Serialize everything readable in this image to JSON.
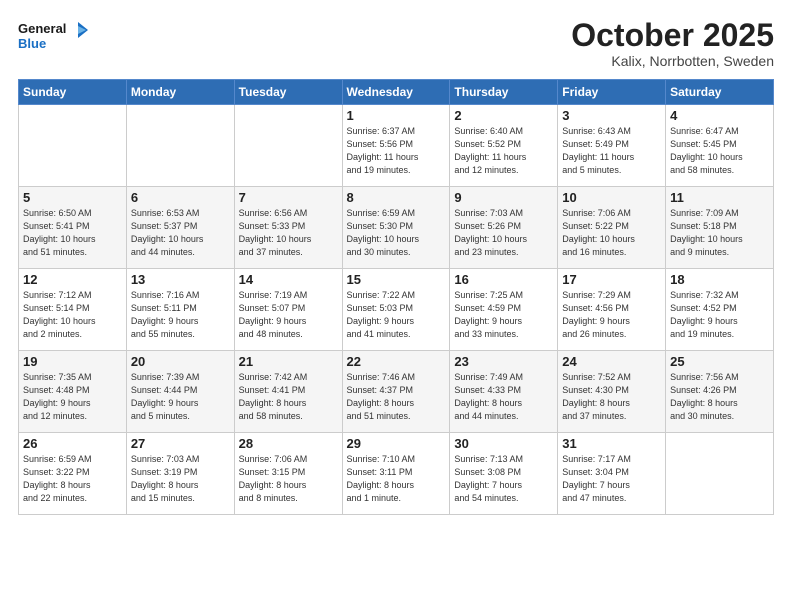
{
  "header": {
    "logo_line1": "General",
    "logo_line2": "Blue",
    "month": "October 2025",
    "location": "Kalix, Norrbotten, Sweden"
  },
  "weekdays": [
    "Sunday",
    "Monday",
    "Tuesday",
    "Wednesday",
    "Thursday",
    "Friday",
    "Saturday"
  ],
  "weeks": [
    [
      {
        "day": "",
        "info": ""
      },
      {
        "day": "",
        "info": ""
      },
      {
        "day": "",
        "info": ""
      },
      {
        "day": "1",
        "info": "Sunrise: 6:37 AM\nSunset: 5:56 PM\nDaylight: 11 hours\nand 19 minutes."
      },
      {
        "day": "2",
        "info": "Sunrise: 6:40 AM\nSunset: 5:52 PM\nDaylight: 11 hours\nand 12 minutes."
      },
      {
        "day": "3",
        "info": "Sunrise: 6:43 AM\nSunset: 5:49 PM\nDaylight: 11 hours\nand 5 minutes."
      },
      {
        "day": "4",
        "info": "Sunrise: 6:47 AM\nSunset: 5:45 PM\nDaylight: 10 hours\nand 58 minutes."
      }
    ],
    [
      {
        "day": "5",
        "info": "Sunrise: 6:50 AM\nSunset: 5:41 PM\nDaylight: 10 hours\nand 51 minutes."
      },
      {
        "day": "6",
        "info": "Sunrise: 6:53 AM\nSunset: 5:37 PM\nDaylight: 10 hours\nand 44 minutes."
      },
      {
        "day": "7",
        "info": "Sunrise: 6:56 AM\nSunset: 5:33 PM\nDaylight: 10 hours\nand 37 minutes."
      },
      {
        "day": "8",
        "info": "Sunrise: 6:59 AM\nSunset: 5:30 PM\nDaylight: 10 hours\nand 30 minutes."
      },
      {
        "day": "9",
        "info": "Sunrise: 7:03 AM\nSunset: 5:26 PM\nDaylight: 10 hours\nand 23 minutes."
      },
      {
        "day": "10",
        "info": "Sunrise: 7:06 AM\nSunset: 5:22 PM\nDaylight: 10 hours\nand 16 minutes."
      },
      {
        "day": "11",
        "info": "Sunrise: 7:09 AM\nSunset: 5:18 PM\nDaylight: 10 hours\nand 9 minutes."
      }
    ],
    [
      {
        "day": "12",
        "info": "Sunrise: 7:12 AM\nSunset: 5:14 PM\nDaylight: 10 hours\nand 2 minutes."
      },
      {
        "day": "13",
        "info": "Sunrise: 7:16 AM\nSunset: 5:11 PM\nDaylight: 9 hours\nand 55 minutes."
      },
      {
        "day": "14",
        "info": "Sunrise: 7:19 AM\nSunset: 5:07 PM\nDaylight: 9 hours\nand 48 minutes."
      },
      {
        "day": "15",
        "info": "Sunrise: 7:22 AM\nSunset: 5:03 PM\nDaylight: 9 hours\nand 41 minutes."
      },
      {
        "day": "16",
        "info": "Sunrise: 7:25 AM\nSunset: 4:59 PM\nDaylight: 9 hours\nand 33 minutes."
      },
      {
        "day": "17",
        "info": "Sunrise: 7:29 AM\nSunset: 4:56 PM\nDaylight: 9 hours\nand 26 minutes."
      },
      {
        "day": "18",
        "info": "Sunrise: 7:32 AM\nSunset: 4:52 PM\nDaylight: 9 hours\nand 19 minutes."
      }
    ],
    [
      {
        "day": "19",
        "info": "Sunrise: 7:35 AM\nSunset: 4:48 PM\nDaylight: 9 hours\nand 12 minutes."
      },
      {
        "day": "20",
        "info": "Sunrise: 7:39 AM\nSunset: 4:44 PM\nDaylight: 9 hours\nand 5 minutes."
      },
      {
        "day": "21",
        "info": "Sunrise: 7:42 AM\nSunset: 4:41 PM\nDaylight: 8 hours\nand 58 minutes."
      },
      {
        "day": "22",
        "info": "Sunrise: 7:46 AM\nSunset: 4:37 PM\nDaylight: 8 hours\nand 51 minutes."
      },
      {
        "day": "23",
        "info": "Sunrise: 7:49 AM\nSunset: 4:33 PM\nDaylight: 8 hours\nand 44 minutes."
      },
      {
        "day": "24",
        "info": "Sunrise: 7:52 AM\nSunset: 4:30 PM\nDaylight: 8 hours\nand 37 minutes."
      },
      {
        "day": "25",
        "info": "Sunrise: 7:56 AM\nSunset: 4:26 PM\nDaylight: 8 hours\nand 30 minutes."
      }
    ],
    [
      {
        "day": "26",
        "info": "Sunrise: 6:59 AM\nSunset: 3:22 PM\nDaylight: 8 hours\nand 22 minutes."
      },
      {
        "day": "27",
        "info": "Sunrise: 7:03 AM\nSunset: 3:19 PM\nDaylight: 8 hours\nand 15 minutes."
      },
      {
        "day": "28",
        "info": "Sunrise: 7:06 AM\nSunset: 3:15 PM\nDaylight: 8 hours\nand 8 minutes."
      },
      {
        "day": "29",
        "info": "Sunrise: 7:10 AM\nSunset: 3:11 PM\nDaylight: 8 hours\nand 1 minute."
      },
      {
        "day": "30",
        "info": "Sunrise: 7:13 AM\nSunset: 3:08 PM\nDaylight: 7 hours\nand 54 minutes."
      },
      {
        "day": "31",
        "info": "Sunrise: 7:17 AM\nSunset: 3:04 PM\nDaylight: 7 hours\nand 47 minutes."
      },
      {
        "day": "",
        "info": ""
      }
    ]
  ]
}
